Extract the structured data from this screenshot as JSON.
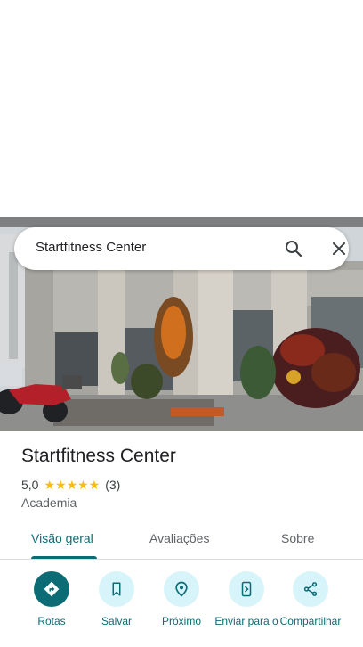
{
  "search": {
    "query": "Startfitness Center",
    "search_icon": "search-icon",
    "close_icon": "close-icon"
  },
  "place": {
    "name": "Startfitness Center",
    "rating": "5,0",
    "stars": "★★★★★",
    "review_count": "(3)",
    "category": "Academia"
  },
  "tabs": [
    {
      "label": "Visão geral",
      "active": true
    },
    {
      "label": "Avaliações",
      "active": false
    },
    {
      "label": "Sobre",
      "active": false
    }
  ],
  "actions": [
    {
      "label": "Rotas",
      "icon": "directions-icon"
    },
    {
      "label": "Salvar",
      "icon": "bookmark-icon"
    },
    {
      "label": "Próximo",
      "icon": "nearby-icon"
    },
    {
      "label": "Enviar para o",
      "icon": "send-to-phone-icon"
    },
    {
      "label": "Compartilhar",
      "icon": "share-icon"
    }
  ],
  "colors": {
    "accent": "#0b6c75",
    "action_bg": "#d7f4fa",
    "star": "#fbbc04"
  }
}
